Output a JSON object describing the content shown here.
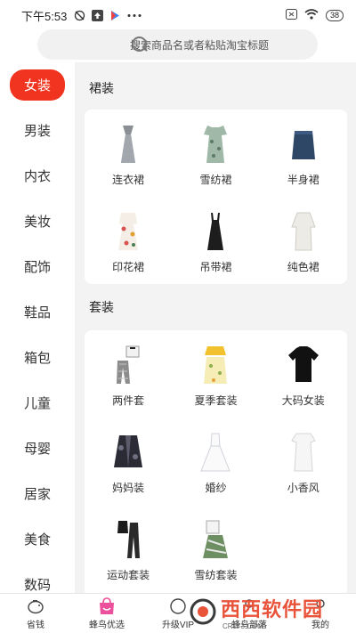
{
  "status_bar": {
    "time": "下午5:53",
    "battery": "38"
  },
  "search": {
    "placeholder": "搜索商品名或者粘贴淘宝标题"
  },
  "sidebar": {
    "items": [
      {
        "label": "女装",
        "active": true
      },
      {
        "label": "男装"
      },
      {
        "label": "内衣"
      },
      {
        "label": "美妆"
      },
      {
        "label": "配饰"
      },
      {
        "label": "鞋品"
      },
      {
        "label": "箱包"
      },
      {
        "label": "儿童"
      },
      {
        "label": "母婴"
      },
      {
        "label": "居家"
      },
      {
        "label": "美食"
      },
      {
        "label": "数码"
      }
    ]
  },
  "sections": [
    {
      "title": "裙装",
      "items": [
        {
          "label": "连衣裙",
          "icon": "dress-gray-icon"
        },
        {
          "label": "雪纺裙",
          "icon": "dress-floral-icon"
        },
        {
          "label": "半身裙",
          "icon": "skirt-denim-icon"
        },
        {
          "label": "印花裙",
          "icon": "dress-print-icon"
        },
        {
          "label": "吊带裙",
          "icon": "dress-black-icon"
        },
        {
          "label": "纯色裙",
          "icon": "dress-white-icon"
        }
      ]
    },
    {
      "title": "套装",
      "items": [
        {
          "label": "两件套",
          "icon": "two-piece-icon"
        },
        {
          "label": "夏季套装",
          "icon": "summer-set-icon"
        },
        {
          "label": "大码女装",
          "icon": "tshirt-black-icon"
        },
        {
          "label": "妈妈装",
          "icon": "cardigan-icon"
        },
        {
          "label": "婚纱",
          "icon": "wedding-dress-icon"
        },
        {
          "label": "小香风",
          "icon": "white-dress-icon"
        },
        {
          "label": "运动套装",
          "icon": "sport-set-icon"
        },
        {
          "label": "雪纺套装",
          "icon": "chiffon-set-icon"
        }
      ]
    }
  ],
  "tabbar": {
    "items": [
      {
        "label": "省钱",
        "icon": "piggy-bank-icon"
      },
      {
        "label": "蜂鸟优选",
        "icon": "shopping-bag-icon"
      },
      {
        "label": "升级VIP",
        "icon": "vip-icon"
      },
      {
        "label": "蜂鸟部落",
        "icon": "tribe-icon"
      },
      {
        "label": "我的",
        "icon": "profile-icon"
      }
    ]
  },
  "watermark": {
    "text": "西西软件园",
    "sub": "CR173.COM"
  }
}
